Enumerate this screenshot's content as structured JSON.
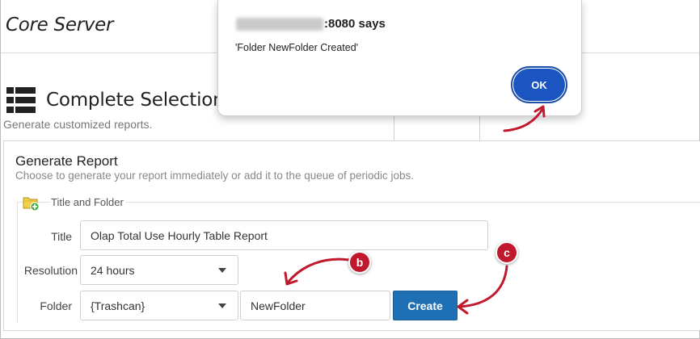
{
  "header": {
    "app_title": "Core Server"
  },
  "page": {
    "icon": "list-icon",
    "title": "Complete Selection",
    "subtitle": "Generate customized reports."
  },
  "panel": {
    "title": "Generate Report",
    "description": "Choose to generate your report immediately or add it to the queue of periodic jobs.",
    "group": {
      "icon": "folder-add-icon",
      "legend": "Title and Folder"
    },
    "fields": {
      "title_label": "Title",
      "title_value": "Olap Total Use Hourly Table Report",
      "resolution_label": "Resolution",
      "resolution_value": "24 hours",
      "folder_label": "Folder",
      "folder_value": "{Trashcan}",
      "new_folder_value": "NewFolder",
      "create_label": "Create"
    }
  },
  "dialog": {
    "origin_suffix": ":8080 says",
    "message": "'Folder NewFolder Created'",
    "ok_label": "OK"
  },
  "callouts": {
    "b": "b",
    "c": "c"
  },
  "colors": {
    "primary_button": "#1f6fb5",
    "ok_button": "#1a55c2",
    "callout": "#c0182c"
  }
}
